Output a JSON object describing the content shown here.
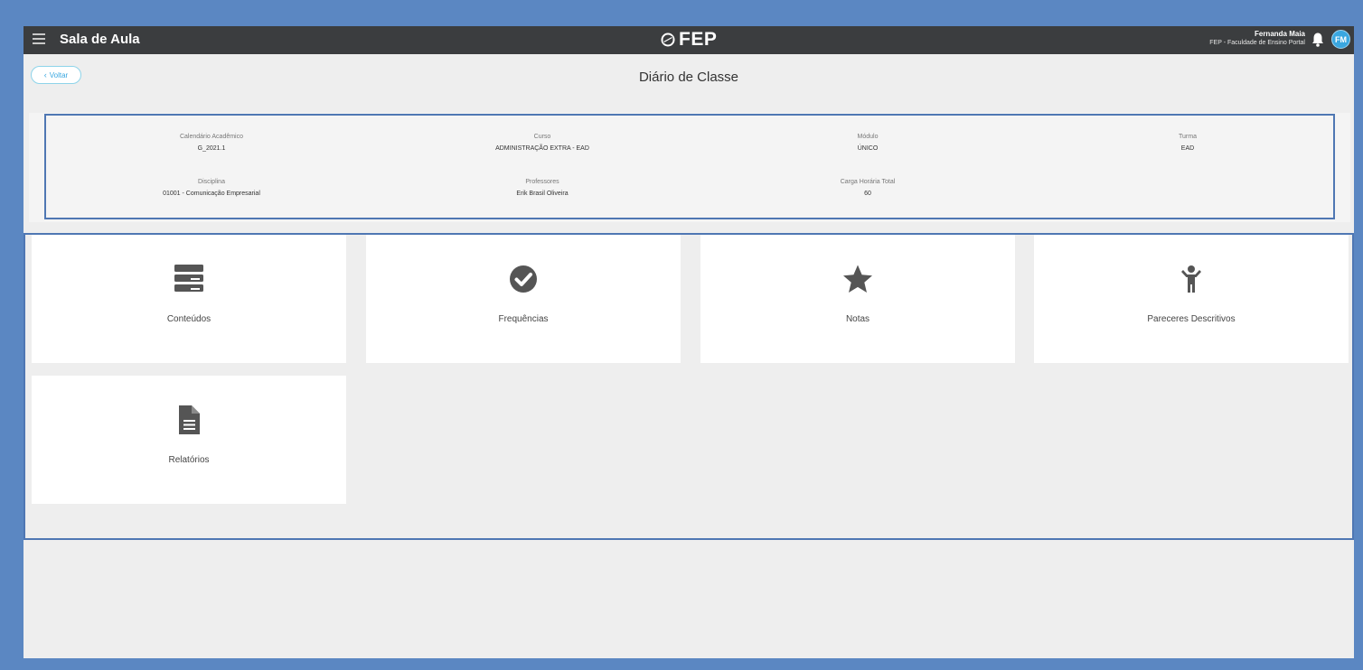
{
  "app": {
    "title": "Sala de Aula",
    "logo_text": "FEP"
  },
  "user": {
    "name": "Fernanda Maia",
    "organization": "FEP - Faculdade de Ensino Portal",
    "initials": "FM"
  },
  "page": {
    "back_label": "Voltar",
    "title": "Diário de Classe"
  },
  "class_info": [
    {
      "label": "Calendário Acadêmico",
      "value": "G_2021.1"
    },
    {
      "label": "Curso",
      "value": "ADMINISTRAÇÃO EXTRA - EAD"
    },
    {
      "label": "Módulo",
      "value": "ÚNICO"
    },
    {
      "label": "Turma",
      "value": "EAD"
    },
    {
      "label": "Disciplina",
      "value": "01001 - Comunicação Empresarial"
    },
    {
      "label": "Professores",
      "value": "Erik Brasil Oliveira"
    },
    {
      "label": "Carga Horária Total",
      "value": "60"
    }
  ],
  "cards": [
    {
      "label": "Conteúdos",
      "icon": "server-icon"
    },
    {
      "label": "Frequências",
      "icon": "check-circle-icon"
    },
    {
      "label": "Notas",
      "icon": "star-icon"
    },
    {
      "label": "Pareceres Descritivos",
      "icon": "child-icon"
    },
    {
      "label": "Relatórios",
      "icon": "file-text-icon"
    }
  ],
  "colors": {
    "topbar": "#3b3d3f",
    "accent": "#3aa7e0",
    "highlight_border": "#4f77b3",
    "icon": "#555555"
  }
}
